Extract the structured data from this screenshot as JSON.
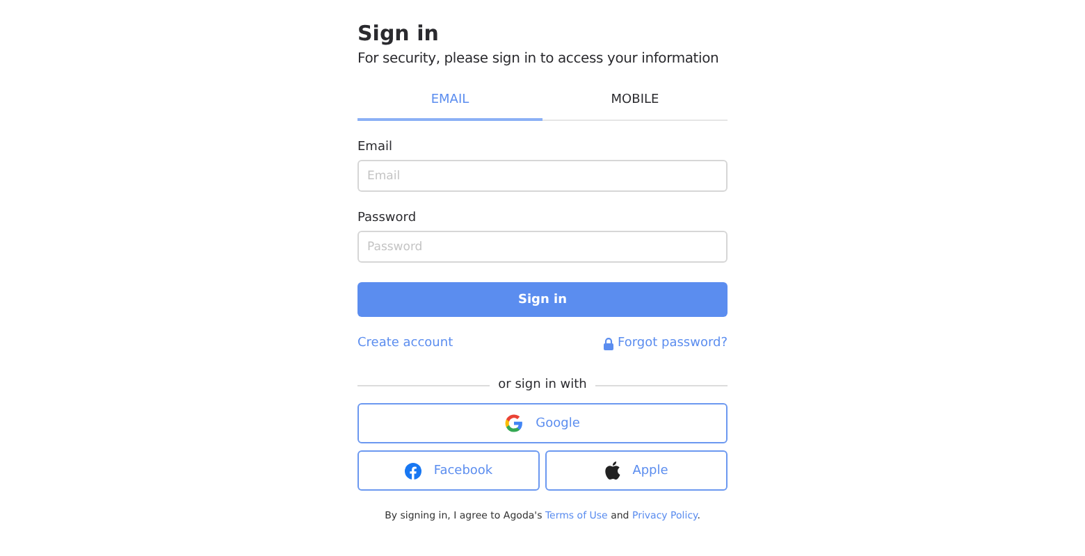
{
  "title": "Sign in",
  "subtitle": "For security, please sign in to access your information",
  "tabs": [
    {
      "label": "EMAIL",
      "selected": true
    },
    {
      "label": "MOBILE",
      "selected": false
    }
  ],
  "fields": [
    {
      "label": "Email",
      "placeholder": "Email"
    },
    {
      "label": "Password",
      "placeholder": "Password"
    }
  ],
  "submit": "Sign in",
  "create_account": "Create account",
  "forgot_password": "Forgot password?",
  "divider": "or sign in with",
  "social": [
    {
      "kind": "google",
      "label": "Google"
    },
    {
      "kind": "facebook",
      "label": "Facebook"
    },
    {
      "kind": "apple",
      "label": "Apple"
    }
  ],
  "terms": [
    {
      "kind": "text",
      "text": "By signing in, I agree to Agoda's "
    },
    {
      "kind": "link",
      "text": "Terms of Use"
    },
    {
      "kind": "text",
      "text": " and "
    },
    {
      "kind": "link",
      "text": "Privacy Policy"
    },
    {
      "kind": "text",
      "text": "."
    }
  ]
}
